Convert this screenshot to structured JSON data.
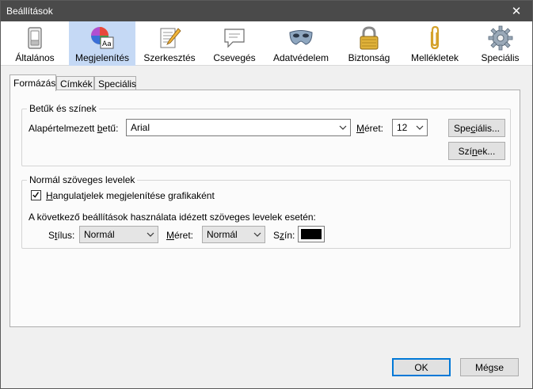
{
  "window": {
    "title": "Beállítások",
    "close_glyph": "✕"
  },
  "toolbar": {
    "items": [
      {
        "label": "Általános",
        "icon": "general-switch-icon"
      },
      {
        "label": "Megjelenítés",
        "icon": "display-palette-icon",
        "selected": true
      },
      {
        "label": "Szerkesztés",
        "icon": "compose-pencil-icon"
      },
      {
        "label": "Csevegés",
        "icon": "chat-bubble-icon"
      },
      {
        "label": "Adatvédelem",
        "icon": "privacy-mask-icon"
      },
      {
        "label": "Biztonság",
        "icon": "security-lock-icon"
      },
      {
        "label": "Mellékletek",
        "icon": "attachment-clip-icon"
      },
      {
        "label": "Speciális",
        "icon": "advanced-gear-icon"
      }
    ]
  },
  "tabs": [
    {
      "label": "Formázás",
      "active": true
    },
    {
      "label": "Címkék"
    },
    {
      "label": "Speciális"
    }
  ],
  "fonts_group": {
    "title": "Betűk és színek",
    "default_font_label_pre": "Alapértelmezett ",
    "default_font_label_u": "b",
    "default_font_label_post": "etű:",
    "default_font_value": "Arial",
    "size_label_u": "M",
    "size_label_post": "éret:",
    "size_value": "12",
    "advanced_button_pre": "Spe",
    "advanced_button_u": "c",
    "advanced_button_post": "iális...",
    "colors_button_pre": "Szí",
    "colors_button_u": "n",
    "colors_button_post": "ek..."
  },
  "plain_group": {
    "title": "Normál szöveges levelek",
    "emoticons_checked": true,
    "emoticons_label_u": "H",
    "emoticons_label_post": "angulatjelek megjelenítése grafikaként",
    "quoted_label": "A következő beállítások használata idézett szöveges levelek esetén:",
    "style_label_pre": "S",
    "style_label_u": "t",
    "style_label_post": "ílus:",
    "style_value": "Normál",
    "size_label_u": "M",
    "size_label_post": "éret:",
    "size_value": "Normál",
    "color_label_pre": "S",
    "color_label_u": "z",
    "color_label_post": "ín:",
    "color_value": "#000000"
  },
  "footer": {
    "ok_label": "OK",
    "cancel_label": "Mégse"
  }
}
